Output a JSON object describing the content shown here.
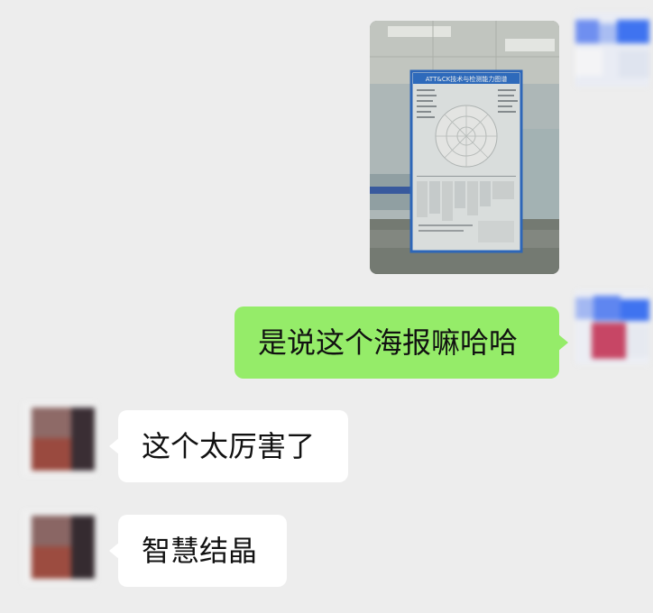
{
  "messages": [
    {
      "direction": "outgoing",
      "type": "image",
      "image": {
        "subject": "office-poster-photo",
        "poster_heading": "ATT&CK技术与检测能力图谱"
      }
    },
    {
      "direction": "outgoing",
      "type": "text",
      "text": "是说这个海报嘛哈哈"
    },
    {
      "direction": "incoming",
      "type": "text",
      "text": "这个太厉害了"
    },
    {
      "direction": "incoming",
      "type": "text",
      "text": "智慧结晶"
    }
  ],
  "colors": {
    "background": "#ededed",
    "outgoing_bubble": "#95ec69",
    "incoming_bubble": "#ffffff",
    "text": "#111111"
  }
}
